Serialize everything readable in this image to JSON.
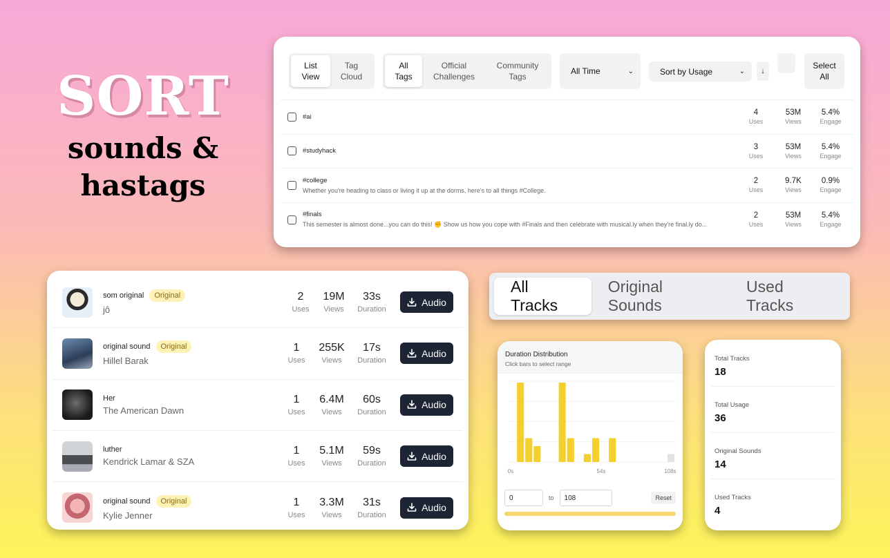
{
  "headline": {
    "big": "SORT",
    "line1": "sounds &",
    "line2": "hastags"
  },
  "tags_panel": {
    "view_toggle": [
      "List\nView",
      "Tag\nCloud"
    ],
    "tag_filter": [
      "All\nTags",
      "Official\nChallenges",
      "Community\nTags"
    ],
    "time_select": "All Time",
    "sort_select": "Sort by Usage",
    "sort_dir": "↓",
    "select_all": "Select\nAll",
    "stat_labels": {
      "uses": "Uses",
      "views": "Views",
      "engage": "Engage"
    },
    "rows": [
      {
        "name": "#ai",
        "desc": "",
        "uses": "4",
        "views": "53M",
        "engage": "5.4%"
      },
      {
        "name": "#studyhack",
        "desc": "",
        "uses": "3",
        "views": "53M",
        "engage": "5.4%"
      },
      {
        "name": "#college",
        "desc": "Whether you're heading to class or living it up at the dorms, here's to all things #College.",
        "uses": "2",
        "views": "9.7K",
        "engage": "0.9%"
      },
      {
        "name": "#finals",
        "desc": "This semester is almost done...you can do this! ✊ Show us how you cope with #Finals and then celebrate with musical.ly when they're final.ly do...",
        "uses": "2",
        "views": "53M",
        "engage": "5.4%"
      }
    ]
  },
  "sounds_panel": {
    "badge": "Original",
    "audio_label": "Audio",
    "stat_labels": {
      "uses": "Uses",
      "views": "Views",
      "duration": "Duration"
    },
    "rows": [
      {
        "title": "som original",
        "artist": "jô",
        "original": true,
        "uses": "2",
        "views": "19M",
        "duration": "33s"
      },
      {
        "title": "original sound",
        "artist": "Hillel Barak",
        "original": true,
        "uses": "1",
        "views": "255K",
        "duration": "17s"
      },
      {
        "title": "Her",
        "artist": "The American Dawn",
        "original": false,
        "uses": "1",
        "views": "6.4M",
        "duration": "60s"
      },
      {
        "title": "luther",
        "artist": "Kendrick Lamar & SZA",
        "original": false,
        "uses": "1",
        "views": "5.1M",
        "duration": "59s"
      },
      {
        "title": "original sound",
        "artist": "Kylie Jenner",
        "original": true,
        "uses": "1",
        "views": "3.3M",
        "duration": "31s"
      }
    ]
  },
  "track_tabs": [
    "All Tracks",
    "Original Sounds",
    "Used Tracks"
  ],
  "distribution": {
    "title": "Duration Distribution",
    "subtitle": "Click bars to select range",
    "range_from": "0",
    "range_to_label": "to",
    "range_to": "108",
    "reset_label": "Reset"
  },
  "chart_data": {
    "type": "bar",
    "title": "Duration Distribution",
    "x_ticks": [
      "0s",
      "54s",
      "108s"
    ],
    "xlim": [
      0,
      108
    ],
    "bar_width_s": 5.4,
    "values": [
      0,
      5,
      1.5,
      1,
      0,
      0,
      5,
      1.5,
      0,
      0.5,
      1.5,
      0,
      1.5,
      0,
      0,
      0,
      0,
      0,
      0,
      0.5
    ],
    "highlight_color": "#f5cf2e",
    "muted_color": "#e2e2e2"
  },
  "totals": [
    {
      "label": "Total Tracks",
      "value": "18"
    },
    {
      "label": "Total Usage",
      "value": "36"
    },
    {
      "label": "Original Sounds",
      "value": "14"
    },
    {
      "label": "Used Tracks",
      "value": "4"
    }
  ]
}
